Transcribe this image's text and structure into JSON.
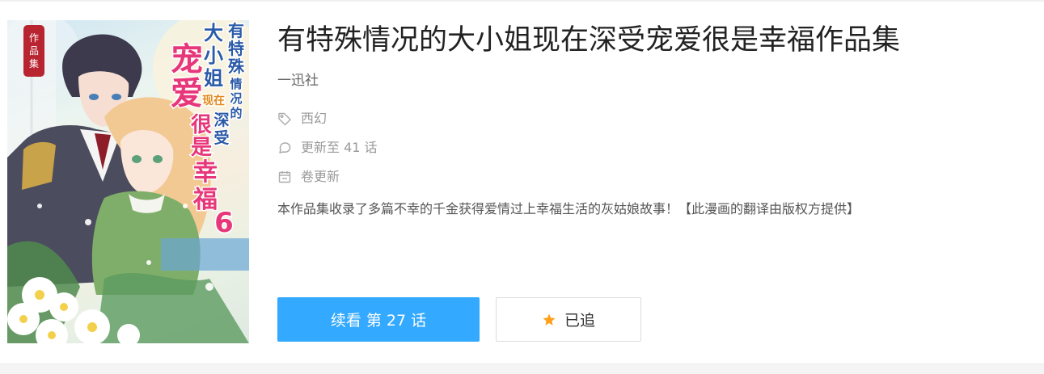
{
  "comic": {
    "title": "有特殊情况的大小姐现在深受宠爱很是幸福作品集",
    "publisher": "一迅社",
    "genre": "西幻",
    "update_status": "更新至 41 话",
    "schedule": "卷更新",
    "description": "本作品集收录了多篇不幸的千金获得爱情过上幸福生活的灰姑娘故事！【此漫画的翻译由版权方提供】"
  },
  "cover": {
    "badge": "作品集",
    "title_lines": [
      "有特殊",
      "情况的",
      "大小姐",
      "现在",
      "深受",
      "宠爱",
      "很是幸福"
    ],
    "volume": "6"
  },
  "actions": {
    "continue_label": "续看 第 27 话",
    "follow_label": "已追"
  },
  "icons": {
    "genre": "tag-icon",
    "update": "speech-bubble-icon",
    "schedule": "calendar-icon",
    "follow": "star-icon"
  },
  "colors": {
    "primary": "#33a9ff",
    "star": "#ff9f1a",
    "muted": "#999999"
  }
}
